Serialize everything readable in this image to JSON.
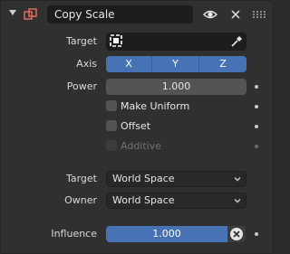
{
  "constraint": {
    "name": "Copy Scale",
    "icon": "constraint-icon",
    "header_icons": [
      "collapse-arrow-icon",
      "eye-icon",
      "close-icon",
      "drag-handle-icon"
    ]
  },
  "target": {
    "label": "Target",
    "value": "",
    "icons": [
      "object-icon",
      "eyedropper-icon"
    ]
  },
  "axis": {
    "label": "Axis",
    "buttons": [
      "X",
      "Y",
      "Z"
    ]
  },
  "power": {
    "label": "Power",
    "value": "1.000"
  },
  "options": [
    {
      "label": "Make Uniform",
      "checked": false,
      "enabled": true
    },
    {
      "label": "Offset",
      "checked": false,
      "enabled": true
    },
    {
      "label": "Additive",
      "checked": false,
      "enabled": false
    }
  ],
  "spaces": {
    "target_label": "Target",
    "target_value": "World Space",
    "owner_label": "Owner",
    "owner_value": "World Space"
  },
  "influence": {
    "label": "Influence",
    "value": "1.000",
    "clear_icon": "x-circle-icon"
  },
  "colors": {
    "accent": "#4772b3",
    "panel": "#303030",
    "field": "#545454",
    "constraint_icon": "#e06c5b"
  }
}
